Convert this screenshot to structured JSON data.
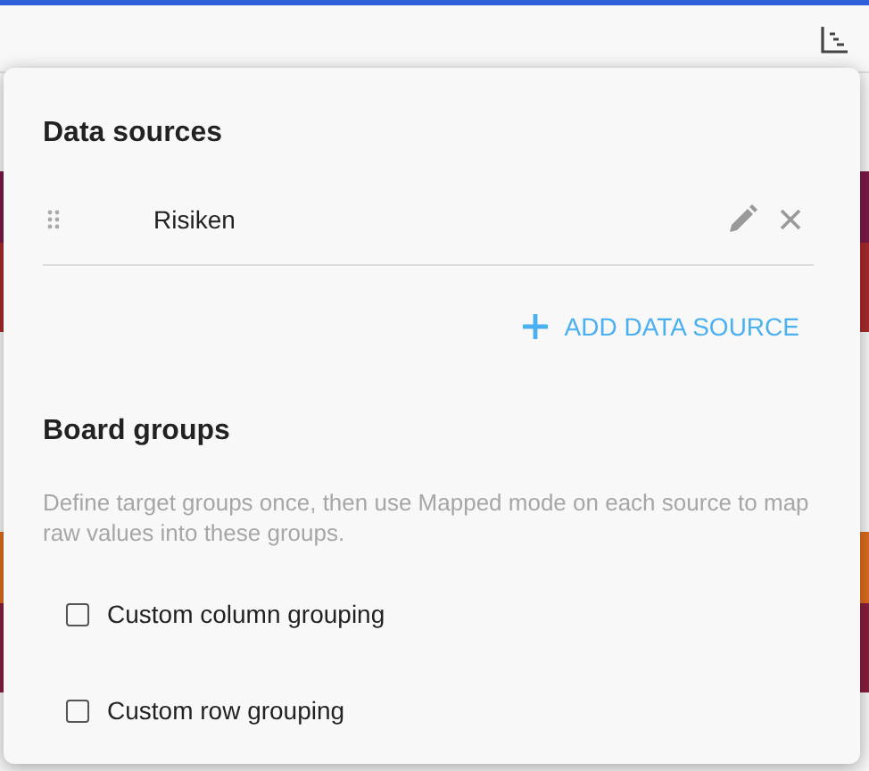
{
  "data_sources": {
    "title": "Data sources",
    "items": [
      {
        "name": "Risiken"
      }
    ],
    "add_button": "ADD DATA SOURCE"
  },
  "board_groups": {
    "title": "Board groups",
    "description": "Define target groups once, then use Mapped mode on each source to map raw values into these groups.",
    "options": [
      {
        "label": "Custom column grouping",
        "checked": false
      },
      {
        "label": "Custom row grouping",
        "checked": false
      }
    ]
  }
}
